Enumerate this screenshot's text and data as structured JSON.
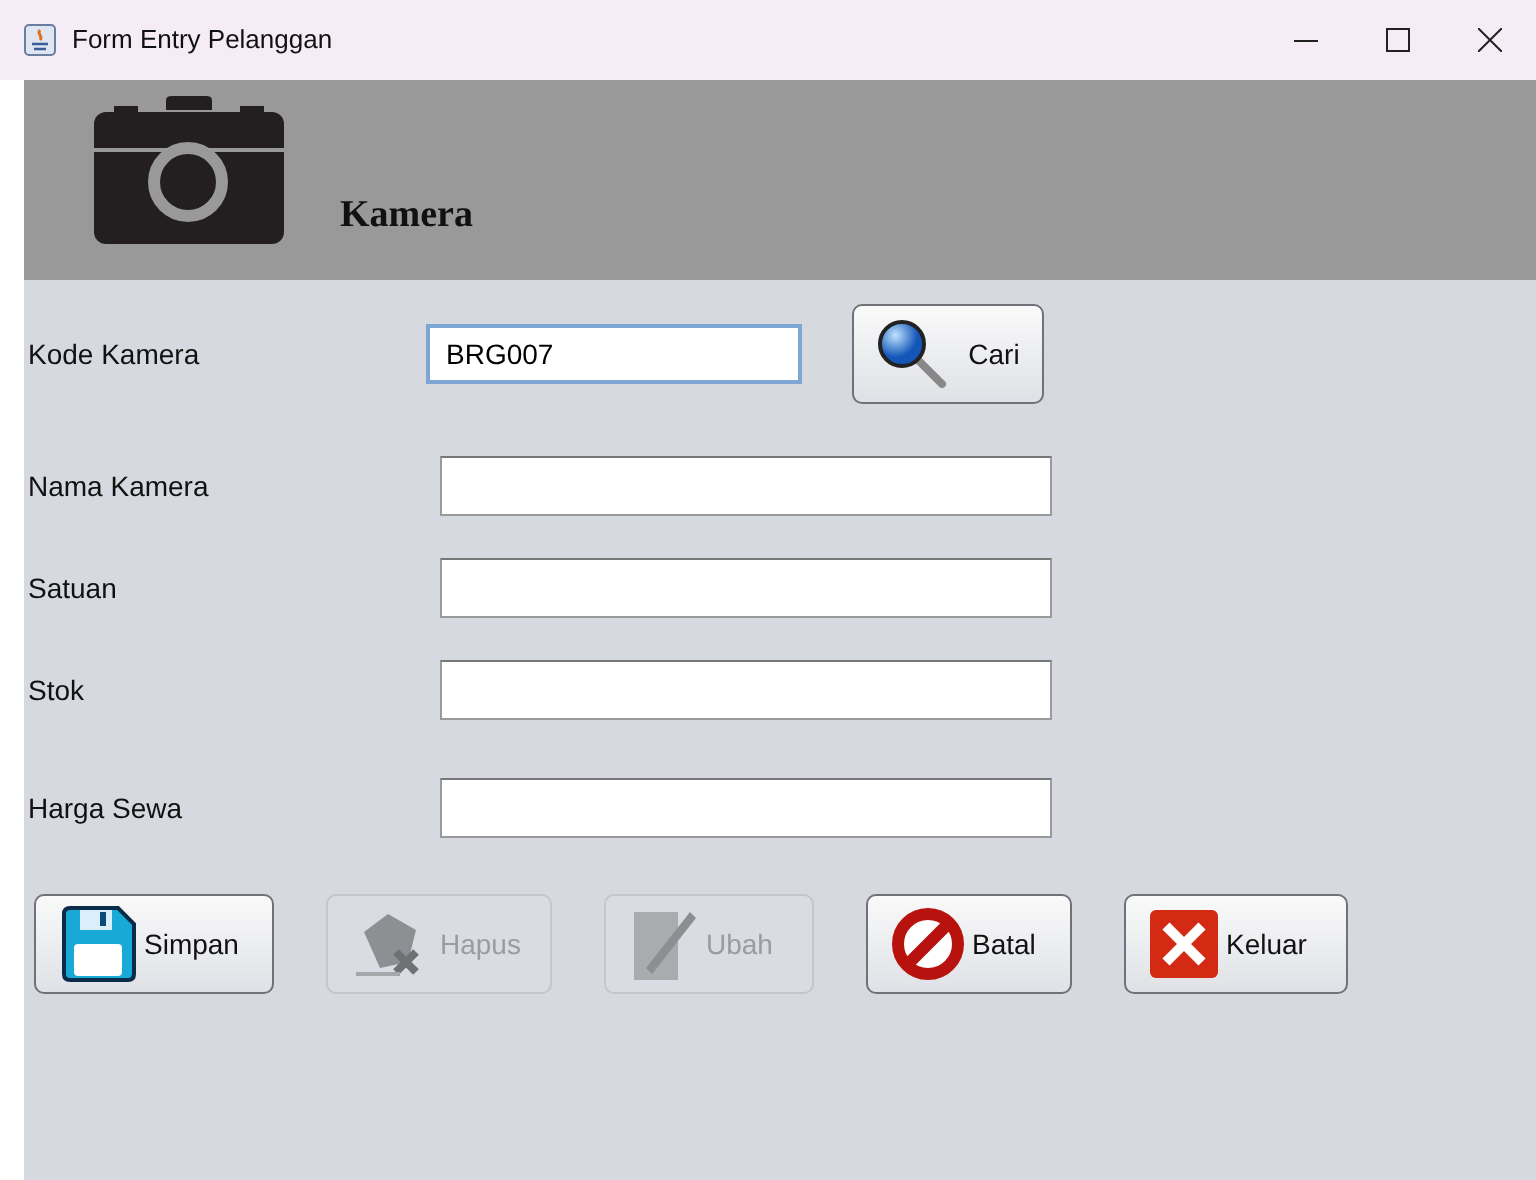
{
  "window": {
    "title": "Form Entry Pelanggan"
  },
  "header": {
    "title": "Kamera"
  },
  "kode": {
    "label": "Kode Kamera",
    "value": "BRG007",
    "focused": true,
    "button": "Cari"
  },
  "fields": [
    {
      "label": "Nama Kamera"
    },
    {
      "label": "Satuan"
    },
    {
      "label": "Stok"
    },
    {
      "label": "Harga Sewa"
    }
  ],
  "buttons": [
    {
      "label": "Simpan",
      "kind": "save",
      "disabled": false
    },
    {
      "label": "Hapus",
      "kind": "delete",
      "disabled": true
    },
    {
      "label": "Ubah",
      "kind": "edit",
      "disabled": true
    },
    {
      "label": "Batal",
      "kind": "cancel",
      "disabled": false
    },
    {
      "label": "Keluar",
      "kind": "exit",
      "disabled": false
    }
  ]
}
